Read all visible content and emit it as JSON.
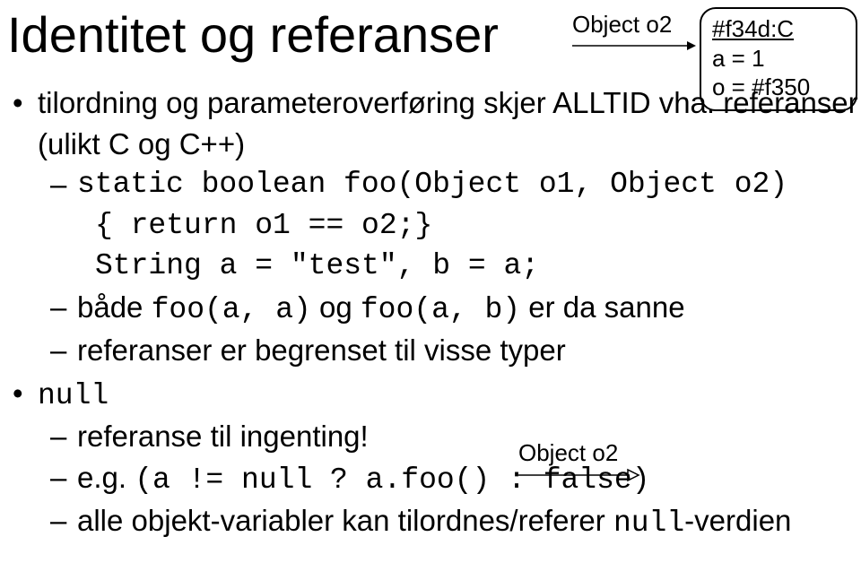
{
  "title": "Identitet og referanser",
  "objectBox": {
    "arrowLabel": "Object o2",
    "line1": "#f34d:C",
    "line2": "a = 1",
    "line3": "o = #f350"
  },
  "bullets": {
    "b1": "tilordning og parameteroverføring skjer ALLTID vha. referanser (ulikt C og C++)",
    "b1_sub1_line1": "static boolean foo(Object o1, Object o2)",
    "b1_sub1_line2": "{ return o1 == o2;}",
    "b1_sub1_line3": "String a = \"test\", b = a;",
    "b1_sub2_pre": "både ",
    "b1_sub2_code1": "foo(a, a)",
    "b1_sub2_mid": " og ",
    "b1_sub2_code2": "foo(a, b)",
    "b1_sub2_post": " er da sanne",
    "b1_sub3": "referanser er begrenset til visse typer",
    "b2": "null",
    "b2_sub1": "referanse til ingenting!",
    "b2_sub2_pre": "e.g. ",
    "b2_sub2_code": "(a != null ? a.foo() : false)",
    "b2_sub3_pre": "alle objekt-variabler kan tilordnes/referer ",
    "b2_sub3_code": "null",
    "b2_sub3_post": "-verdien"
  },
  "nullArrow": {
    "label": "Object o2"
  }
}
